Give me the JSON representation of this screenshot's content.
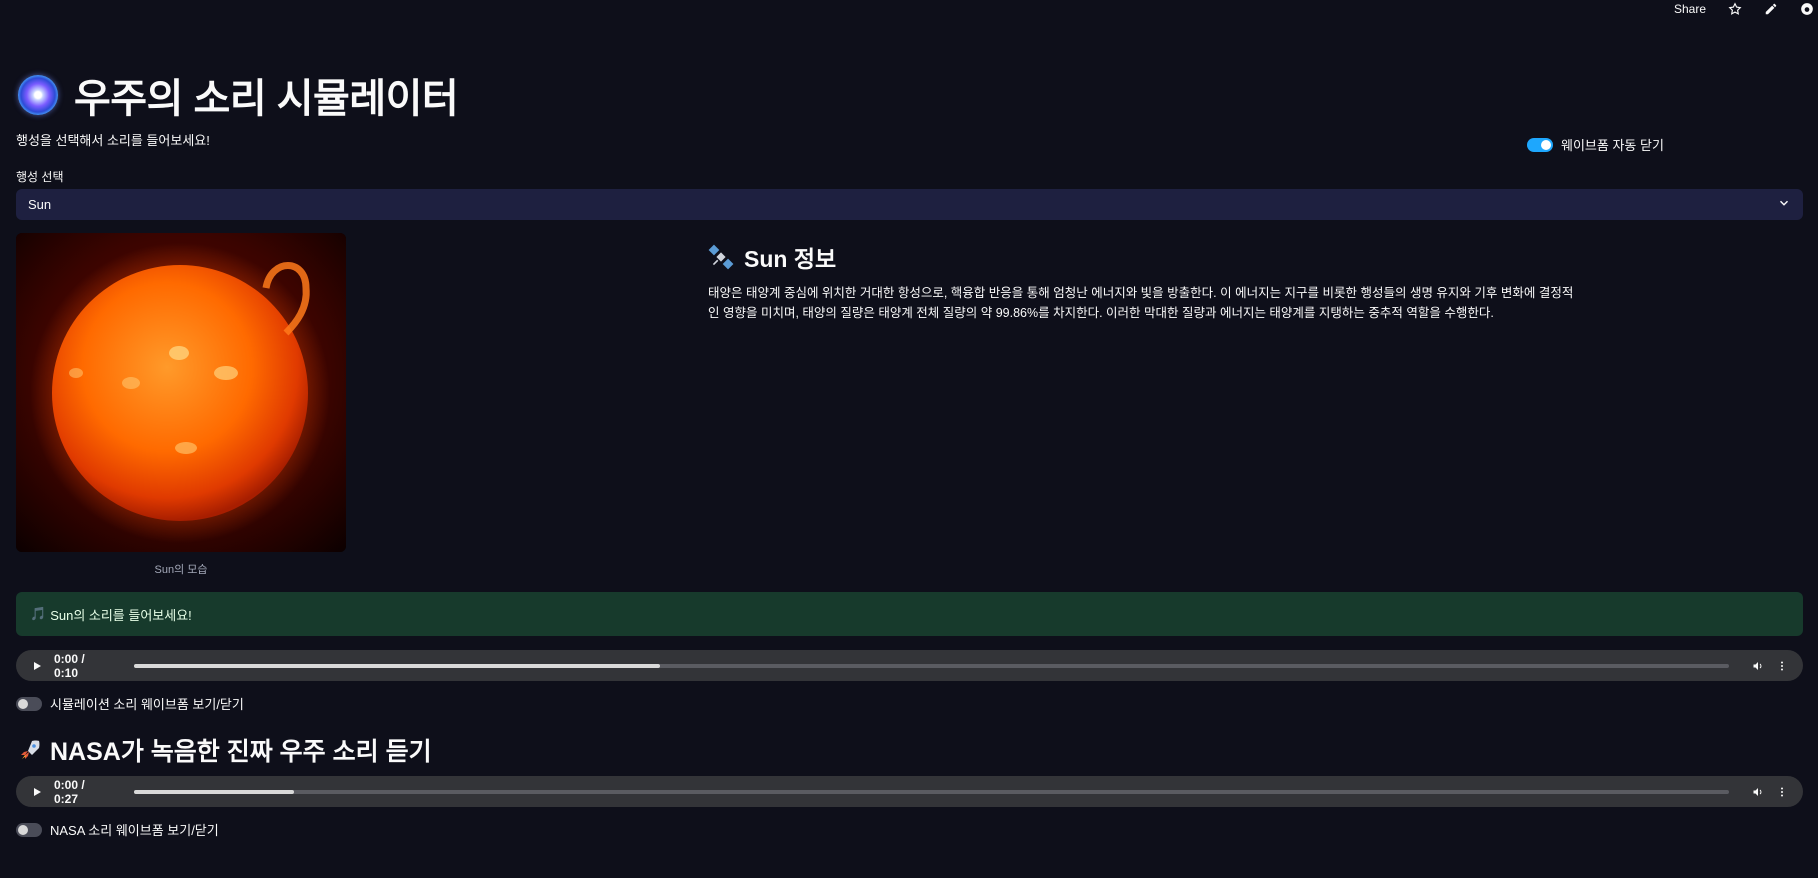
{
  "topbar": {
    "share_label": "Share"
  },
  "header": {
    "title": "우주의 소리 시뮬레이터",
    "subtitle": "행성을 선택해서 소리를 들어보세요!"
  },
  "waveform_auto_close": {
    "label": "웨이브폼 자동 닫기",
    "checked": true
  },
  "planet_select": {
    "label": "행성 선택",
    "value": "Sun"
  },
  "image": {
    "caption": "Sun의 모습"
  },
  "info": {
    "title": "Sun 정보",
    "text": "태양은 태양계 중심에 위치한 거대한 항성으로, 핵융합 반응을 통해 엄청난 에너지와 빛을 방출한다. 이 에너지는 지구를 비롯한 행성들의 생명 유지와 기후 변화에 결정적인 영향을 미치며, 태양의 질량은 태양계 전체 질량의 약 99.86%를 차지한다. 이러한 막대한 질량과 에너지는 태양계를 지탱하는 중추적 역할을 수행한다."
  },
  "success": {
    "message": "Sun의 소리를 들어보세요!"
  },
  "sim_audio": {
    "time": "0:00 / 0:10",
    "progress_fraction": 0.33
  },
  "sim_waveform_toggle": {
    "label": "시뮬레이션 소리 웨이브폼 보기/닫기",
    "checked": false
  },
  "nasa": {
    "title": "NASA가 녹음한 진짜 우주 소리 듣기"
  },
  "nasa_audio": {
    "time": "0:00 / 0:27",
    "progress_fraction": 0.1
  },
  "nasa_waveform_toggle": {
    "label": "NASA 소리 웨이브폼 보기/닫기",
    "checked": false
  }
}
